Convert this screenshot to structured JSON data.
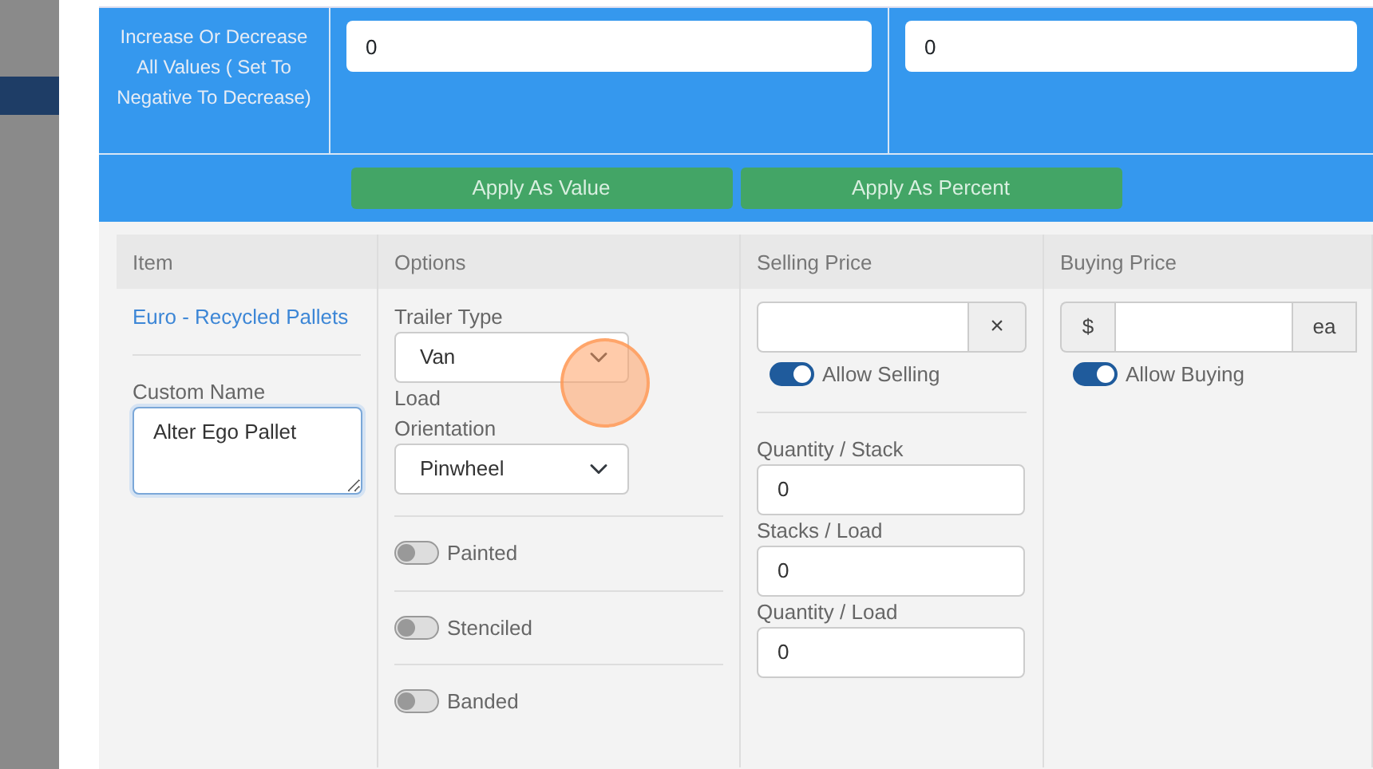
{
  "adjust": {
    "label": "Increase Or Decrease All Values ( Set To Negative To Decrease)",
    "fields": [
      {
        "value": "0"
      },
      {
        "value": "0"
      }
    ],
    "buttons": [
      "Apply As Value",
      "Apply As Percent"
    ]
  },
  "table": {
    "columns": [
      "Item",
      "Options",
      "Selling Price",
      "Buying Price"
    ],
    "row": {
      "item": {
        "link": "Euro - Recycled Pallets",
        "custom_name_label": "Custom Name",
        "custom_name": "Alter Ego Pallet"
      },
      "options": {
        "selects": [
          {
            "label": "Trailer Type",
            "value": "Van"
          },
          {
            "label": "Load Orientation",
            "value": "Pinwheel"
          }
        ],
        "toggles": [
          {
            "label": "Painted",
            "on": false
          },
          {
            "label": "Stenciled",
            "on": false
          },
          {
            "label": "Banded",
            "on": false
          }
        ]
      },
      "selling": {
        "clear": "×",
        "toggle": {
          "label": "Allow Selling",
          "on": true
        },
        "fields": [
          {
            "label": "Quantity / Stack",
            "value": "0"
          },
          {
            "label": "Stacks / Load",
            "value": "0"
          },
          {
            "label": "Quantity / Load",
            "value": "0"
          }
        ]
      },
      "buying": {
        "prefix": "$",
        "suffix": "ea",
        "toggle": {
          "label": "Allow Buying",
          "on": true
        }
      }
    }
  }
}
